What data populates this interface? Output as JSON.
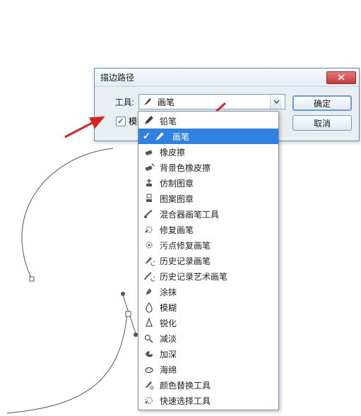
{
  "dialog": {
    "title": "描边路径",
    "tool_label": "工具:",
    "simulate_label": "模拟压力",
    "simulate_checked": true,
    "ok": "确定",
    "cancel": "取消",
    "combo_selected": "画笔"
  },
  "dropdown": {
    "selected_index": 1,
    "items": [
      {
        "label": "铅笔",
        "icon": "pencil-icon"
      },
      {
        "label": "画笔",
        "icon": "brush-icon"
      },
      {
        "label": "橡皮擦",
        "icon": "eraser-icon"
      },
      {
        "label": "背景色橡皮擦",
        "icon": "bg-eraser-icon"
      },
      {
        "label": "仿制图章",
        "icon": "clone-stamp-icon"
      },
      {
        "label": "图案图章",
        "icon": "pattern-stamp-icon"
      },
      {
        "label": "混合器画笔工具",
        "icon": "mixer-brush-icon"
      },
      {
        "label": "修复画笔",
        "icon": "healing-brush-icon"
      },
      {
        "label": "污点修复画笔",
        "icon": "spot-healing-icon"
      },
      {
        "label": "历史记录画笔",
        "icon": "history-brush-icon"
      },
      {
        "label": "历史记录艺术画笔",
        "icon": "art-history-brush-icon"
      },
      {
        "label": "涂抹",
        "icon": "smudge-icon"
      },
      {
        "label": "模糊",
        "icon": "blur-icon"
      },
      {
        "label": "锐化",
        "icon": "sharpen-icon"
      },
      {
        "label": "减淡",
        "icon": "dodge-icon"
      },
      {
        "label": "加深",
        "icon": "burn-icon"
      },
      {
        "label": "海绵",
        "icon": "sponge-icon"
      },
      {
        "label": "颜色替换工具",
        "icon": "color-replace-icon"
      },
      {
        "label": "快速选择工具",
        "icon": "quick-select-icon"
      }
    ]
  },
  "colors": {
    "highlight": "#2f82e0",
    "arrow": "#d62323",
    "dialog_border": "#6b8aad"
  }
}
